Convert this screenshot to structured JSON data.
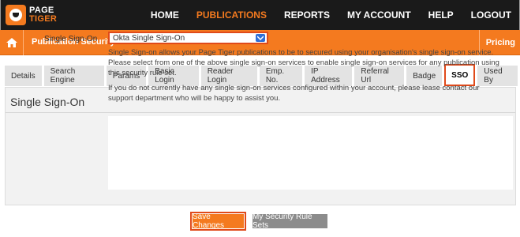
{
  "brand": {
    "line1": "PAGE",
    "line2": "TIGER"
  },
  "nav": {
    "items": [
      {
        "label": "HOME",
        "active": false
      },
      {
        "label": "PUBLICATIONS",
        "active": true
      },
      {
        "label": "REPORTS",
        "active": false
      },
      {
        "label": "MY ACCOUNT",
        "active": false
      },
      {
        "label": "HELP",
        "active": false
      },
      {
        "label": "LOGOUT",
        "active": false
      }
    ]
  },
  "subheader": {
    "title": "Publication Security Rule Set",
    "pricing": "Pricing"
  },
  "tabs": [
    {
      "label": "Details"
    },
    {
      "label": "Search Engine"
    },
    {
      "label": "Params"
    },
    {
      "label": "Basic Login"
    },
    {
      "label": "Reader Login"
    },
    {
      "label": "Emp. No."
    },
    {
      "label": "IP Address"
    },
    {
      "label": "Referral Url"
    },
    {
      "label": "Badge"
    },
    {
      "label": "SSO"
    },
    {
      "label": "Used By"
    }
  ],
  "section": {
    "title": "Single Sign-On",
    "field_label": "Single Sign-On",
    "selected_value": "Okta Single Sign-On",
    "help1": "Single Sign-on allows your Page Tiger publications to be to secured using your organisation's single sign-on service. Please select from one of the above single sign-on services to enable single sign-on services for any publication using this security rule set.",
    "help2": "If you do not currently have any single sign-on services configured within your account, please lease contact our support department who will be happy to assist you."
  },
  "buttons": {
    "save": "Save Changes",
    "rules": "My Security Rule Sets"
  },
  "colors": {
    "accent": "#f47a1f",
    "highlight": "#e04a1a",
    "nav_bg": "#1a1a1a"
  },
  "icons": {
    "home": "home-icon",
    "dropdown": "chevron-down-icon"
  }
}
